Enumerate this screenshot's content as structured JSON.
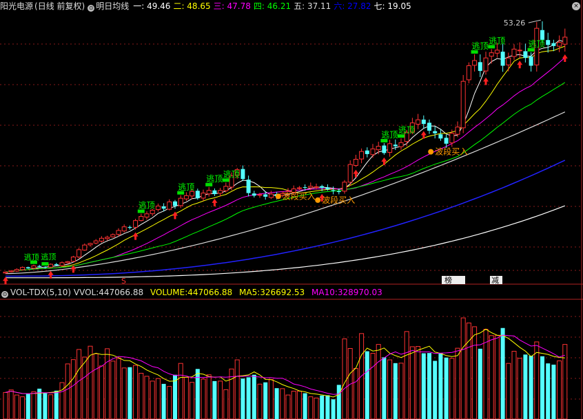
{
  "header": {
    "stock": "阳光电源",
    "mode": "(日线 前复权)",
    "indicator": "明日均线",
    "ma": [
      {
        "label": "一:",
        "value": "49.46",
        "color": "#ffffff"
      },
      {
        "label": "二:",
        "value": "48.65",
        "color": "#ffff00"
      },
      {
        "label": "三:",
        "value": "47.78",
        "color": "#ff00ff"
      },
      {
        "label": "四:",
        "value": "46.21",
        "color": "#00ff00"
      },
      {
        "label": "五:",
        "value": "37.11",
        "color": "#dddddd"
      },
      {
        "label": "六:",
        "value": "27.82",
        "color": "#0000ff"
      },
      {
        "label": "七:",
        "value": "19.05",
        "color": "#ffffff"
      }
    ]
  },
  "volume_header": {
    "name": "VOL-TDX(5,10)",
    "vvol_label": "VVOL:",
    "vvol_value": "447066.88",
    "volume_label": "VOLUME:",
    "volume_value": "447066.88",
    "ma5_label": "MA5:",
    "ma5_value": "326692.53",
    "ma10_label": "MA10:",
    "ma10_value": "328970.03"
  },
  "labels": {
    "escape": "逃顶",
    "buy": "波段买入",
    "high_price": "53.26",
    "marker_s": "S",
    "marker_bang": "榜",
    "marker_jian": "减"
  },
  "chart_data": [
    {
      "type": "candlestick",
      "title": "明日均线",
      "n": 100,
      "ylim": [
        4.5,
        56
      ],
      "series": [
        {
          "name": "一",
          "color": "#ffffff"
        },
        {
          "name": "二",
          "color": "#ffff00"
        },
        {
          "name": "三",
          "color": "#ff00ff"
        },
        {
          "name": "四",
          "color": "#00ff00"
        },
        {
          "name": "五",
          "color": "#dddddd"
        },
        {
          "name": "六",
          "color": "#0000ff"
        },
        {
          "name": "七",
          "color": "#ffffff"
        }
      ],
      "close": [
        6.3,
        6.5,
        6.8,
        7.2,
        7.0,
        7.5,
        7.3,
        7.2,
        7.8,
        7.6,
        8.1,
        8.3,
        9.2,
        10.6,
        11.5,
        11.8,
        12.3,
        12.8,
        13.0,
        13.5,
        14.3,
        15.0,
        14.8,
        16.2,
        17.0,
        17.5,
        18.2,
        19.0,
        18.5,
        19.8,
        19.0,
        20.5,
        21.0,
        21.8,
        20.5,
        21.5,
        22.0,
        21.3,
        22.0,
        22.8,
        24.8,
        26.0,
        24.2,
        21.5,
        21.0,
        21.2,
        20.8,
        21.3,
        20.9,
        21.4,
        21.8,
        22.3,
        22.5,
        22.6,
        22.8,
        22.7,
        22.5,
        22.2,
        21.9,
        21.7,
        23.6,
        27.0,
        28.0,
        29.5,
        29.0,
        30.0,
        30.5,
        29.2,
        31.0,
        30.5,
        31.2,
        33.2,
        35.0,
        35.6,
        34.8,
        33.5,
        33.0,
        32.0,
        31.0,
        33.0,
        34.2,
        43.0,
        46.0,
        47.0,
        45.0,
        47.5,
        48.5,
        49.0,
        46.0,
        47.5,
        49.2,
        49.0,
        47.5,
        46.0,
        53.2,
        51.0,
        50.0,
        49.8,
        50.5,
        51.5
      ],
      "vol": [
        105,
        115,
        95,
        88,
        99,
        108,
        120,
        102,
        96,
        112,
        144,
        218,
        235,
        275,
        245,
        288,
        258,
        210,
        278,
        229,
        239,
        202,
        205,
        212,
        181,
        169,
        150,
        160,
        139,
        129,
        175,
        220,
        165,
        145,
        198,
        158,
        175,
        150,
        150,
        116,
        198,
        234,
        160,
        165,
        175,
        138,
        145,
        156,
        122,
        120,
        95,
        110,
        110,
        102,
        88,
        83,
        93,
        94,
        78,
        135,
        317,
        279,
        200,
        338,
        268,
        260,
        295,
        244,
        234,
        221,
        221,
        346,
        286,
        287,
        260,
        261,
        230,
        261,
        243,
        240,
        280,
        400,
        380,
        365,
        278,
        355,
        330,
        330,
        360,
        220,
        268,
        240,
        255,
        250,
        305,
        248,
        220,
        215,
        230,
        295
      ]
    }
  ]
}
